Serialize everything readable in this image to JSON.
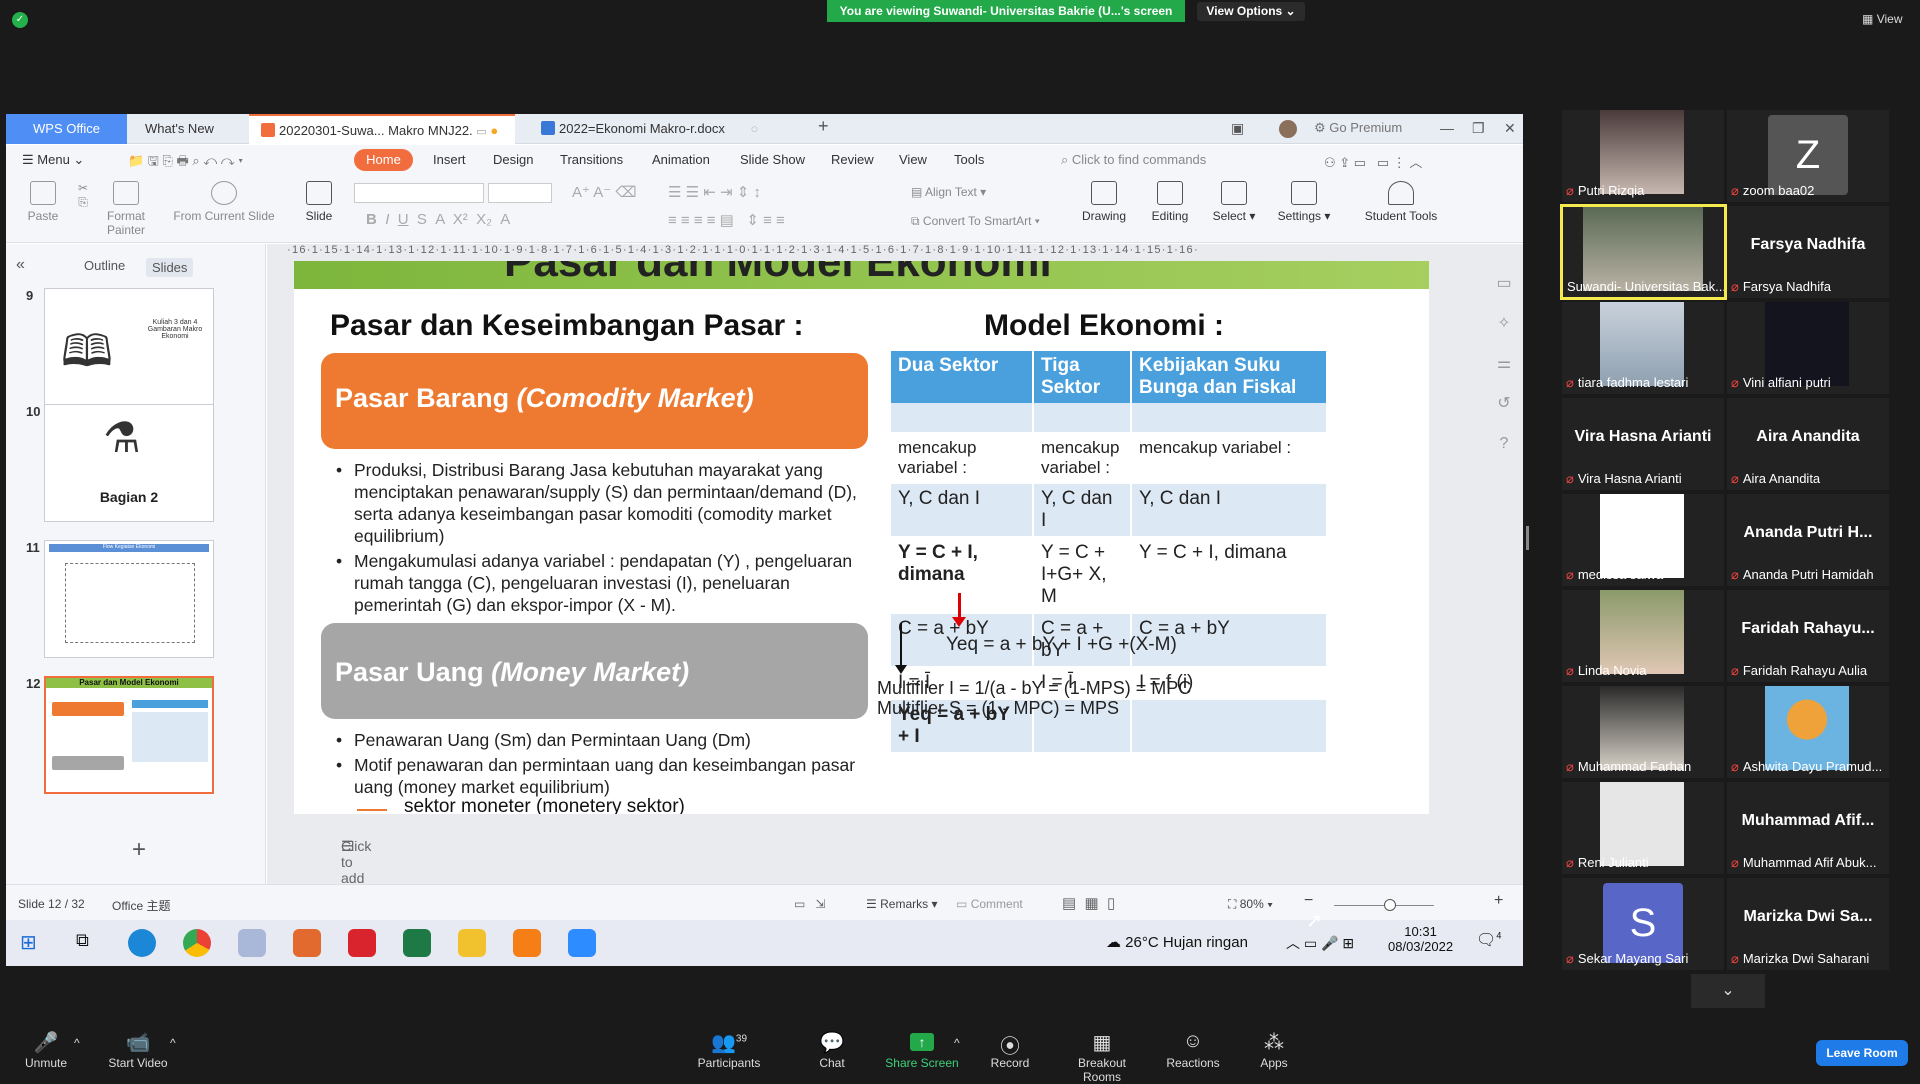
{
  "zoom_top": {
    "banner": "You are viewing Suwandi- Universitas Bakrie (U...'s screen",
    "view_options": "View Options",
    "view": "View"
  },
  "wps": {
    "logo_tab": "WPS Office",
    "tabs": [
      "What's New",
      "20220301-Suwa... Makro MNJ22.",
      "2022=Ekonomi Makro-r.docx"
    ],
    "go_premium": "Go Premium",
    "menu": [
      "Menu",
      "Home",
      "Insert",
      "Design",
      "Transitions",
      "Animation",
      "Slide Show",
      "Review",
      "View",
      "Tools"
    ],
    "find": "Click to find commands",
    "ribbon": {
      "paste": "Paste",
      "format_painter": "Format Painter",
      "from_current_slide": "From Current Slide",
      "slide": "Slide",
      "align_text": "Align Text",
      "convert_smartart": "Convert To SmartArt",
      "drawing": "Drawing",
      "editing": "Editing",
      "select": "Select",
      "settings": "Settings",
      "student_tools": "Student Tools"
    },
    "panel_tabs": [
      "Outline",
      "Slides"
    ],
    "thumbs": [
      {
        "num": "9",
        "caption": "Kuliah 3 dan 4 Gambaran Makro Ekonomi"
      },
      {
        "num": "10",
        "caption": "Bagian 2"
      },
      {
        "num": "11",
        "caption": "Flow Kegiatan Ekonomi"
      },
      {
        "num": "12",
        "caption": "Pasar dan Model Ekonomi"
      }
    ],
    "ruler": "·16·1·15·1·14·1·13·1·12·1·11·1·10·1·9·1·8·1·7·1·6·1·5·1·4·1·3·1·2·1·1·1·0·1·1·1·2·1·3·1·4·1·5·1·6·1·7·1·8·1·9·1·10·1·11·1·12·1·13·1·14·1·15·1·16·",
    "notes": "Click to add notes",
    "status": {
      "slide_count": "Slide 12 / 32",
      "theme": "Office 主题",
      "remarks": "Remarks",
      "comment": "Comment",
      "zoom": "80%"
    }
  },
  "slide": {
    "title": "Pasar dan Model Ekonomi",
    "left_heading": "Pasar dan Keseimbangan Pasar  :",
    "right_heading": "Model Ekonomi :",
    "box1_plain": "Pasar Barang ",
    "box1_italic": "(Comodity Market)",
    "box2_plain": "Pasar Uang ",
    "box2_italic": "(Money Market)",
    "bullets1": [
      "Produksi, Distribusi Barang Jasa kebutuhan mayarakat yang menciptakan penawaran/supply (S) dan permintaan/demand (D), serta adanya keseimbangan pasar komoditi (comodity market equilibrium)",
      "Mengakumulasi adanya variabel :  pendapatan (Y) , pengeluaran rumah tangga (C), pengeluaran investasi (I), peneluaran pemerintah (G) dan ekspor-impor (X - M)."
    ],
    "bullets2": [
      "Penawaran Uang (Sm) dan Permintaan Uang (Dm)",
      "Motif penawaran dan permintaan uang dan keseimbangan pasar uang (money market equilibrium)"
    ],
    "sektor": "sektor moneter  (monetery sektor)",
    "table": {
      "headers": [
        "Dua Sektor",
        "Tiga Sektor",
        "Kebijakan Suku Bunga dan Fiskal"
      ],
      "rows": [
        [
          "",
          "",
          ""
        ],
        [
          "mencakup variabel :",
          "mencakup variabel :",
          "mencakup variabel :"
        ],
        [
          "Y, C dan I",
          "Y, C dan I",
          "Y, C dan I"
        ],
        [
          "Y = C + I, dimana",
          "Y = C + I+G+ X, M",
          "Y = C + I, dimana"
        ],
        [
          "C = a + bY",
          "C = a + bY",
          "C = a + bY"
        ],
        [
          "I = Ī",
          "I = Ī",
          "I = f (i)"
        ],
        [
          "Yeq = a + bY + I",
          "",
          ""
        ]
      ]
    },
    "yeq_note": "Yeq = a + bY + I +G +(X-M)",
    "multiplier1": "Multiflier I = 1/(a - bY = (1-MPS) = MPC",
    "multiplier2": "Multiflier S = (1 - MPC) = MPS"
  },
  "taskbar": {
    "weather": "26°C  Hujan ringan",
    "time": "10:31",
    "date": "08/03/2022",
    "notif_count": "4"
  },
  "participants": [
    {
      "name": "Putri Rizqia",
      "type": "video"
    },
    {
      "name": "zoom baa02",
      "type": "avatar",
      "letter": "Z"
    },
    {
      "name": "Suwandi- Universitas Bak...",
      "type": "video",
      "active": true
    },
    {
      "name": "Farsya Nadhifa",
      "type": "name",
      "display": "Farsya Nadhifa"
    },
    {
      "name": "tiara fadhma lestari",
      "type": "video"
    },
    {
      "name": "Vini alfiani putri",
      "type": "video"
    },
    {
      "name": "Vira Hasna Arianti",
      "type": "name",
      "display": "Vira Hasna Arianti"
    },
    {
      "name": "Aira Ananditа",
      "type": "name",
      "display": "Aira Ananditа"
    },
    {
      "name": "medissa salwa",
      "type": "video"
    },
    {
      "name": "Ananda Putri Hamidah",
      "type": "name",
      "display": "Ananda Putri H..."
    },
    {
      "name": "Linda Novia",
      "type": "video"
    },
    {
      "name": "Faridah Rahayu Aulia",
      "type": "name",
      "display": "Faridah Rahayu..."
    },
    {
      "name": "Muhammad Farhan",
      "type": "video"
    },
    {
      "name": "Ashwita Dayu Pramud...",
      "type": "video"
    },
    {
      "name": "Reni Julianti",
      "type": "video"
    },
    {
      "name": "Muhammad Afif Abuk...",
      "type": "name",
      "display": "Muhammad Afif..."
    },
    {
      "name": "Sekar Mayang Sari",
      "type": "avatar",
      "letter": "S"
    },
    {
      "name": "Marizka Dwi Saharani",
      "type": "name",
      "display": "Marizka Dwi Sa..."
    }
  ],
  "controls": {
    "unmute": "Unmute",
    "start_video": "Start Video",
    "participants": "Participants",
    "participants_count": "39",
    "chat": "Chat",
    "share_screen": "Share Screen",
    "record": "Record",
    "breakout": "Breakout Rooms",
    "reactions": "Reactions",
    "apps": "Apps",
    "leave": "Leave Room"
  },
  "colors": {
    "banner_green": "#23a94a",
    "wps_orange": "#f26d3d",
    "table_blue": "#4aa0dd",
    "box_orange": "#ee7a31",
    "leave_blue": "#1e7be8"
  }
}
